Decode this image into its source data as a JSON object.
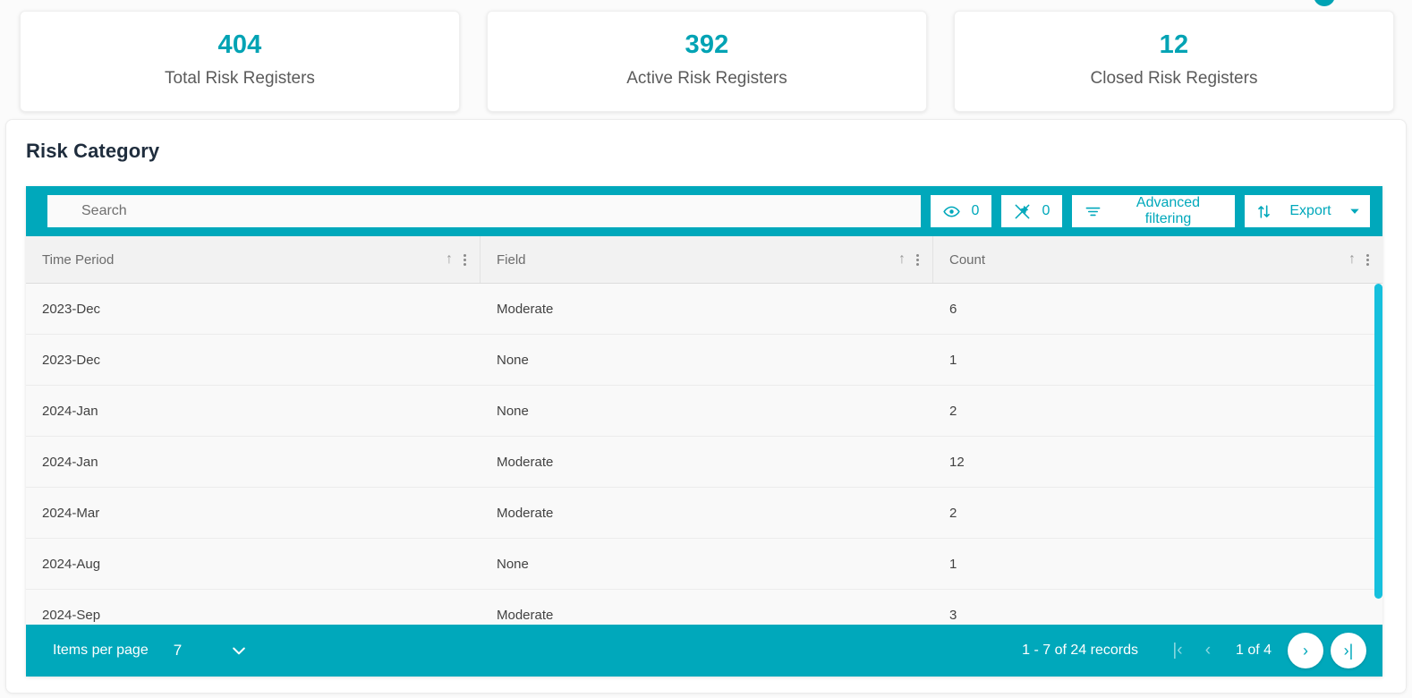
{
  "stats": [
    {
      "value": "404",
      "label": "Total Risk Registers"
    },
    {
      "value": "392",
      "label": "Active Risk Registers"
    },
    {
      "value": "12",
      "label": "Closed Risk Registers"
    }
  ],
  "panel": {
    "title": "Risk Category"
  },
  "toolbar": {
    "search_placeholder": "Search",
    "search_value": "",
    "visible_count": "0",
    "pinned_count": "0",
    "advanced_filtering_label": "Advanced filtering",
    "export_label": "Export"
  },
  "table": {
    "columns": [
      {
        "label": "Time Period"
      },
      {
        "label": "Field"
      },
      {
        "label": "Count"
      }
    ],
    "rows": [
      {
        "time_period": "2023-Dec",
        "field": "Moderate",
        "count": "6"
      },
      {
        "time_period": "2023-Dec",
        "field": "None",
        "count": "1"
      },
      {
        "time_period": "2024-Jan",
        "field": "None",
        "count": "2"
      },
      {
        "time_period": "2024-Jan",
        "field": "Moderate",
        "count": "12"
      },
      {
        "time_period": "2024-Mar",
        "field": "Moderate",
        "count": "2"
      },
      {
        "time_period": "2024-Aug",
        "field": "None",
        "count": "1"
      },
      {
        "time_period": "2024-Sep",
        "field": "Moderate",
        "count": "3"
      }
    ]
  },
  "footer": {
    "items_per_page_label": "Items per page",
    "items_per_page_value": "7",
    "records_label": "1 - 7 of 24 records",
    "page_label": "1 of 4"
  },
  "colors": {
    "accent": "#00a8bb",
    "stat_value": "#00a3b4",
    "scrollbar": "#16c0dd"
  }
}
